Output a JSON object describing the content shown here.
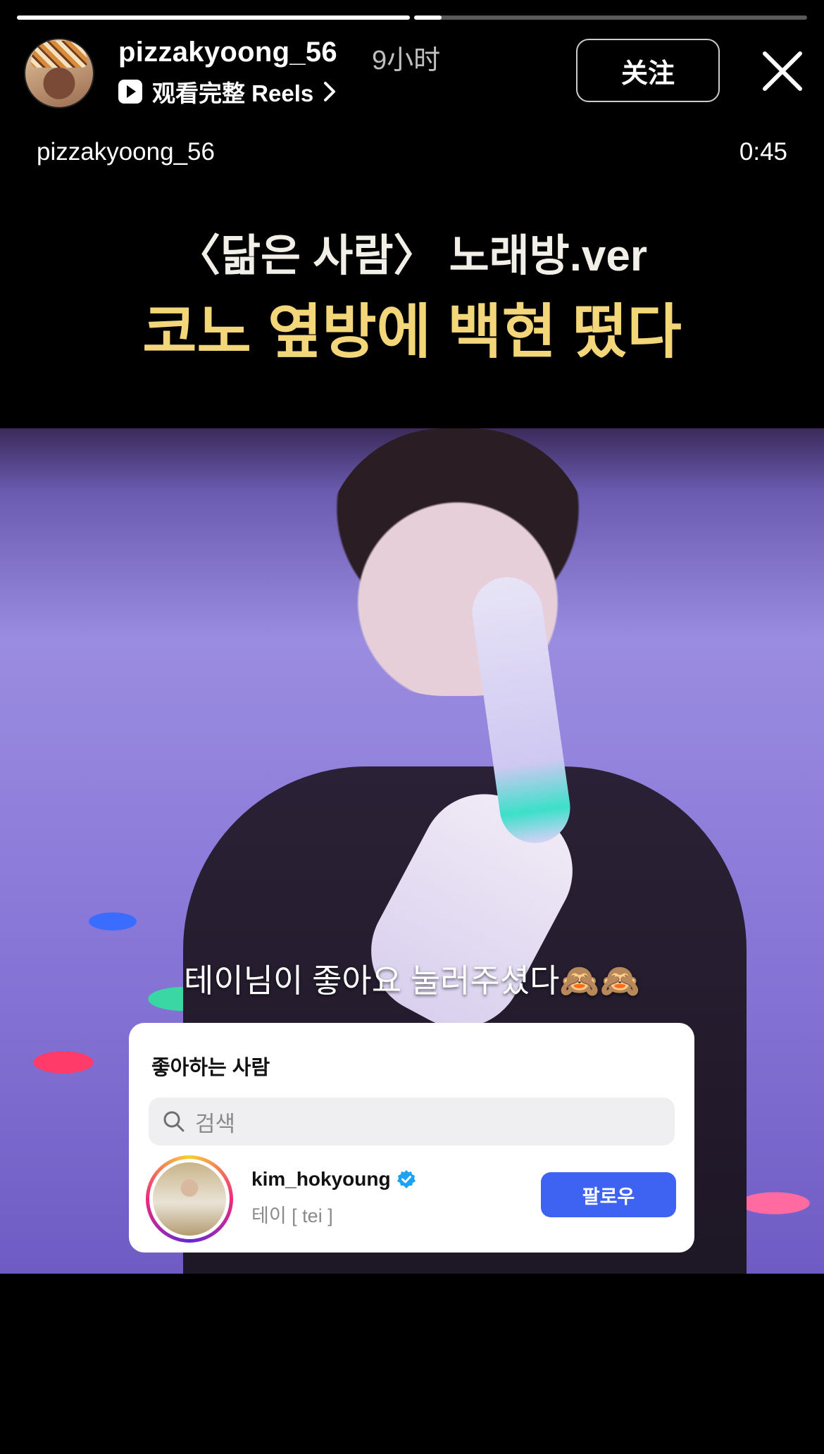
{
  "story": {
    "progress": [
      1.0,
      0.07
    ],
    "username": "pizzakyoong_56",
    "time_ago": "9小时",
    "watch_reels_label": "观看完整 Reels",
    "follow_label": "关注"
  },
  "reel": {
    "username": "pizzakyoong_56",
    "duration": "0:45",
    "headline_line1": "〈닮은 사람〉 노래방.ver",
    "headline_line2": "코노 옆방에 백현 떴다",
    "subtitle": "테이님이 좋아요 눌러주셨다🙈🙈"
  },
  "likes_card": {
    "title": "좋아하는 사람",
    "search_placeholder": "검색",
    "users": [
      {
        "username": "kim_hokyoung",
        "full_name": "테이 [ tei ]",
        "verified": true,
        "follow_label": "팔로우"
      }
    ]
  },
  "colors": {
    "headline_yellow": "#f3d67a",
    "follow_blue": "#3e63f2",
    "verified_blue": "#1da1f2"
  }
}
